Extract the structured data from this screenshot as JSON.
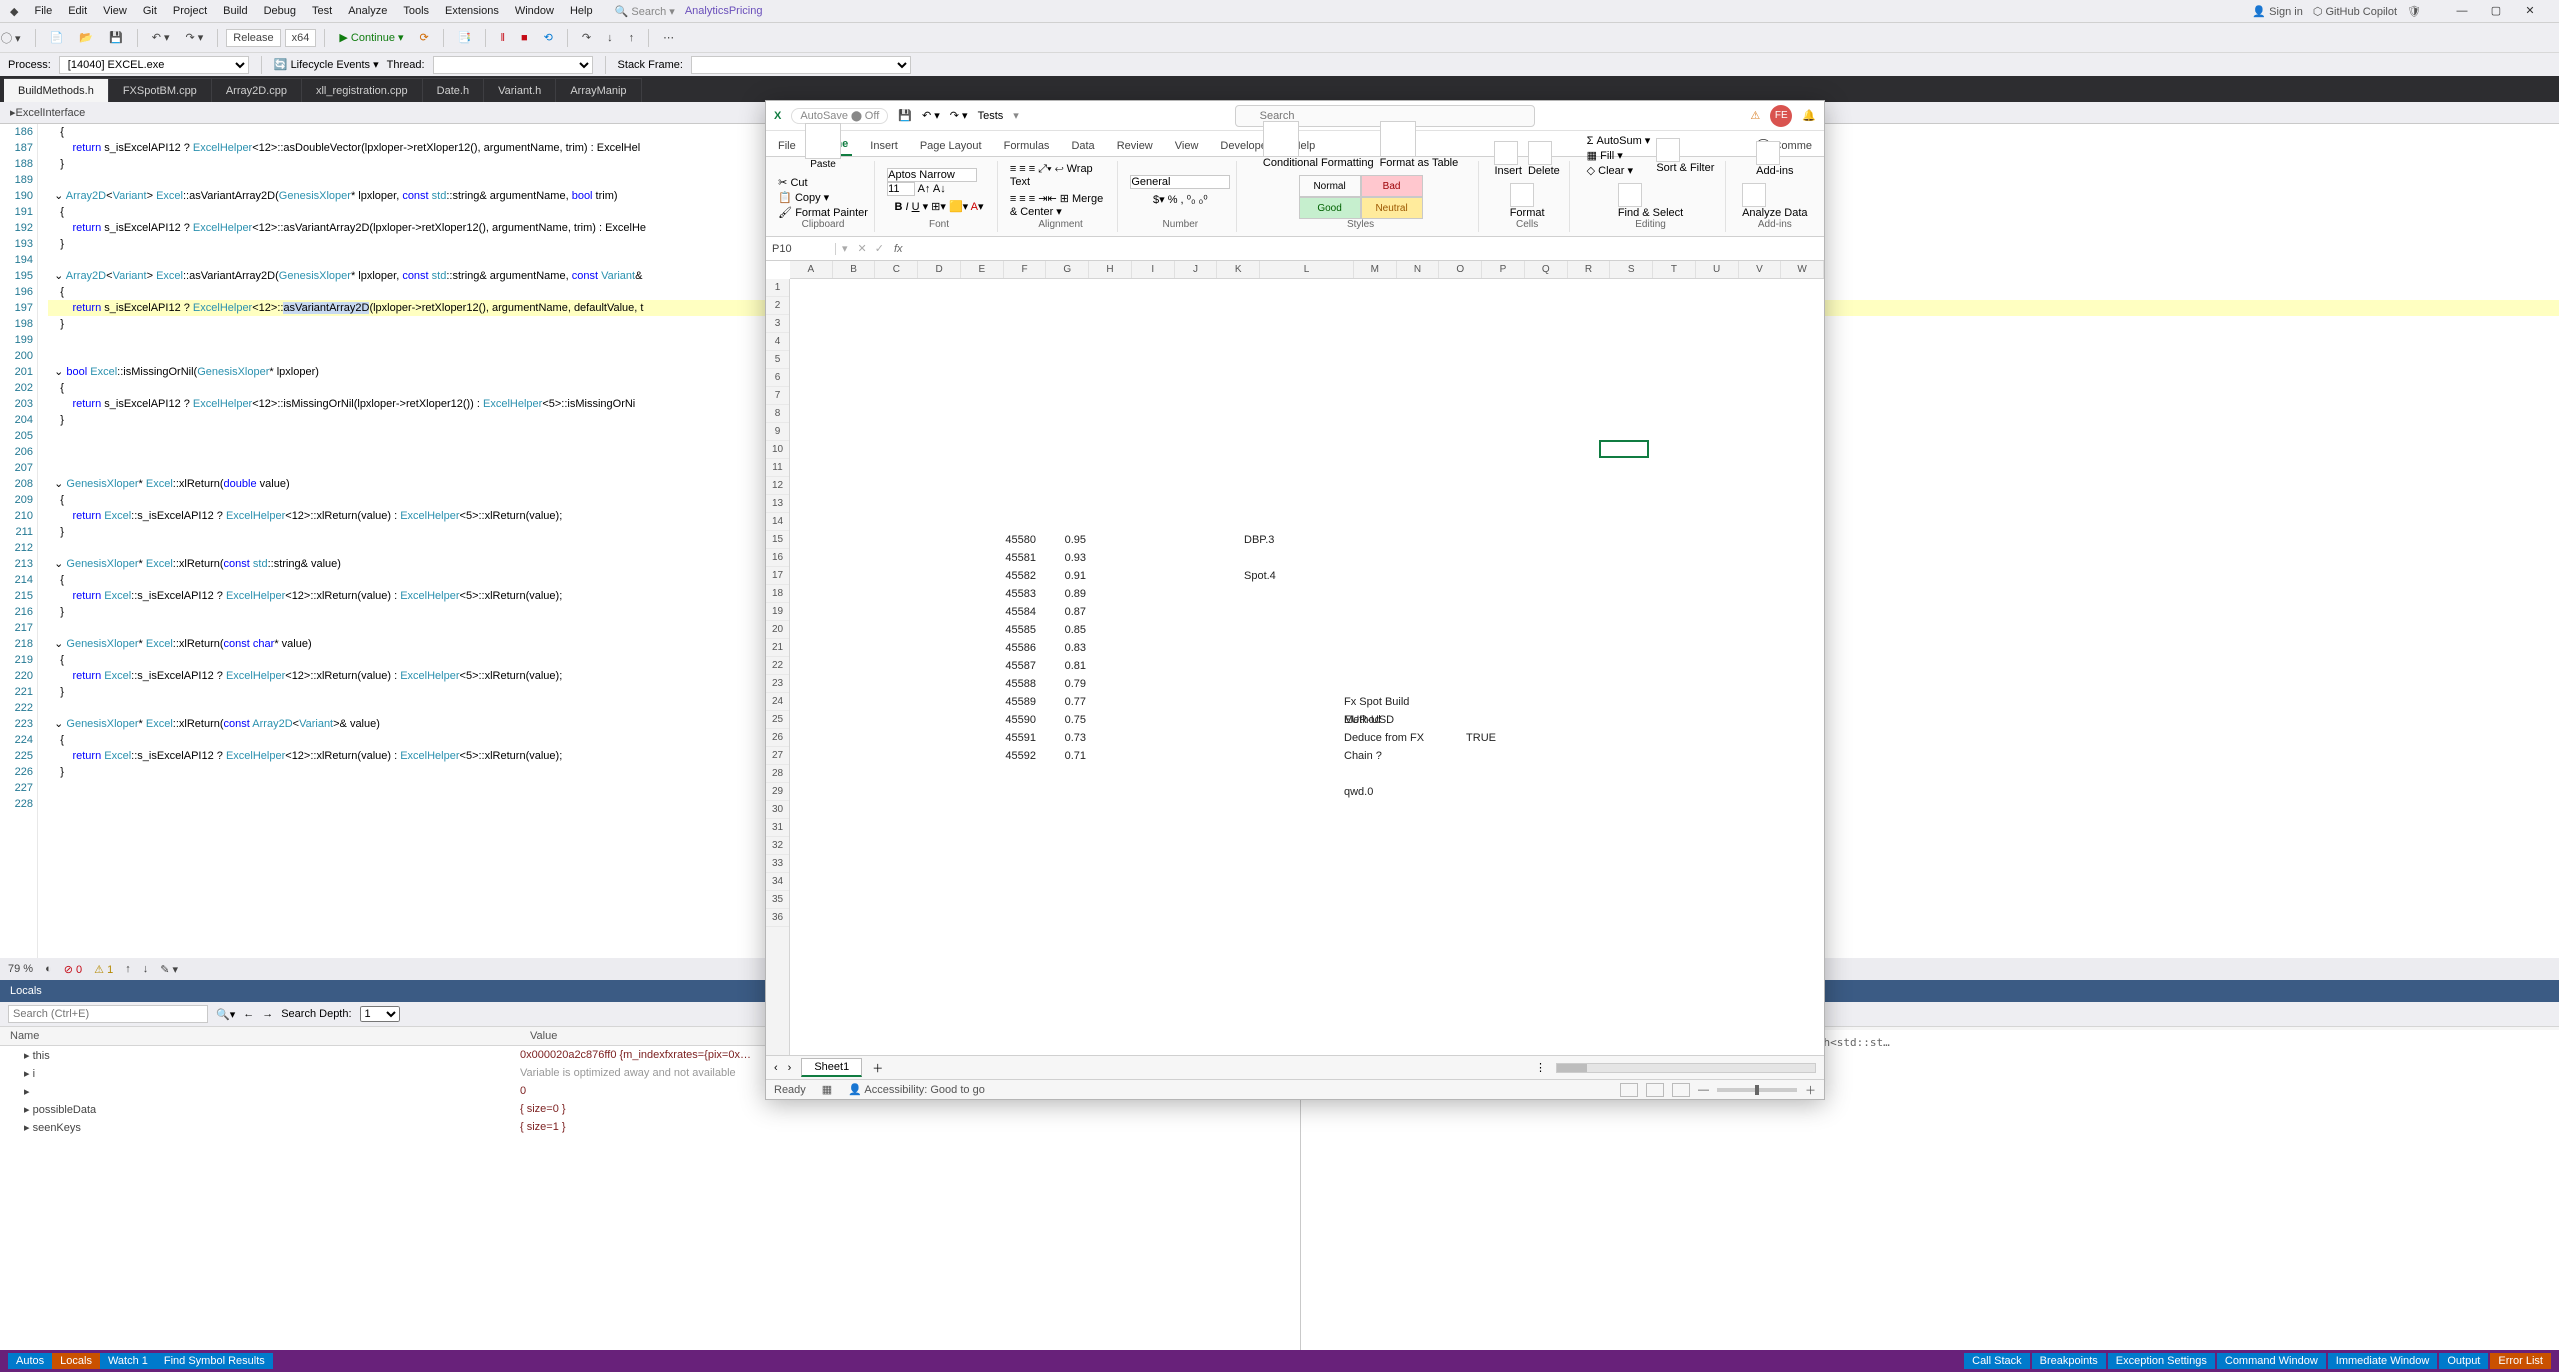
{
  "vs": {
    "menus": [
      "File",
      "Edit",
      "View",
      "Git",
      "Project",
      "Build",
      "Debug",
      "Test",
      "Analyze",
      "Tools",
      "Extensions",
      "Window",
      "Help"
    ],
    "search_placeholder": "Search",
    "right_link": "AnalyticsPricing",
    "signin": "Sign in",
    "copilot": "GitHub Copilot",
    "toolbar": {
      "config": "Release",
      "platform": "x64",
      "continue": "Continue"
    },
    "process": {
      "label": "Process:",
      "value": "[14040] EXCEL.exe",
      "lifecycle": "Lifecycle Events",
      "thread": "Thread:",
      "stack": "Stack Frame:"
    },
    "tabs": [
      "BuildMethods.h",
      "FXSpotBM.cpp",
      "Array2D.cpp",
      "xll_registration.cpp",
      "Date.h",
      "Variant.h",
      "ArrayManip"
    ],
    "active_tab": 0,
    "subheader": "ExcelInterface",
    "code_start_line": 186,
    "lines": [
      "    {",
      "        return s_isExcelAPI12 ? ExcelHelper<12>::asDoubleVector(lpxloper->retXloper12(), argumentName, trim) : ExcelHel",
      "    }",
      "",
      "  ⌄ Array2D<Variant> Excel::asVariantArray2D(GenesisXloper* lpxloper, const std::string& argumentName, bool trim)",
      "    {",
      "        return s_isExcelAPI12 ? ExcelHelper<12>::asVariantArray2D(lpxloper->retXloper12(), argumentName, trim) : ExcelHe",
      "    }",
      "",
      "  ⌄ Array2D<Variant> Excel::asVariantArray2D(GenesisXloper* lpxloper, const std::string& argumentName, const Variant&",
      "    {",
      "        return s_isExcelAPI12 ? ExcelHelper<12>::asVariantArray2D(lpxloper->retXloper12(), argumentName, defaultValue, t",
      "    }",
      "",
      "",
      "  ⌄ bool Excel::isMissingOrNil(GenesisXloper* lpxloper)",
      "    {",
      "        return s_isExcelAPI12 ? ExcelHelper<12>::isMissingOrNil(lpxloper->retXloper12()) : ExcelHelper<5>::isMissingOrNi",
      "    }",
      "",
      "",
      "",
      "  ⌄ GenesisXloper* Excel::xlReturn(double value)",
      "    {",
      "        return Excel::s_isExcelAPI12 ? ExcelHelper<12>::xlReturn(value) : ExcelHelper<5>::xlReturn(value);",
      "    }",
      "",
      "  ⌄ GenesisXloper* Excel::xlReturn(const std::string& value)",
      "    {",
      "        return Excel::s_isExcelAPI12 ? ExcelHelper<12>::xlReturn(value) : ExcelHelper<5>::xlReturn(value);",
      "    }",
      "",
      "  ⌄ GenesisXloper* Excel::xlReturn(const char* value)",
      "    {",
      "        return Excel::s_isExcelAPI12 ? ExcelHelper<12>::xlReturn(value) : ExcelHelper<5>::xlReturn(value);",
      "    }",
      "",
      "  ⌄ GenesisXloper* Excel::xlReturn(const Array2D<Variant>& value)",
      "    {",
      "        return Excel::s_isExcelAPI12 ? ExcelHelper<12>::xlReturn(value) : ExcelHelper<5>::xlReturn(value);",
      "    }",
      "",
      ""
    ],
    "debug_line_index": 11,
    "highlight_token": "asVariantArray2D",
    "midbar": {
      "zoom": "79 %",
      "errors": "0",
      "warnings": "1"
    },
    "locals": {
      "title": "Locals",
      "search_ph": "Search (Ctrl+E)",
      "depth_label": "Search Depth:",
      "depth_value": "1",
      "cols": [
        "Name",
        "Value"
      ],
      "rows": [
        {
          "n": "this",
          "v": "0x000020a2c876ff0 {m_indexfxrates={pix=0x…",
          "gray": false
        },
        {
          "n": "i",
          "v": "Variable is optimized away and not available",
          "gray": true
        },
        {
          "n": "",
          "v": "0",
          "gray": false
        },
        {
          "n": "possibleData",
          "v": "{ size=0 }",
          "gray": false
        },
        {
          "n": "seenKeys",
          "v": "{ size=1 }",
          "gray": false
        }
      ]
    },
    "watch_text": "std::vector<bool,std::allocator<bool>>\nstd::unordered_set<std::string,std::hash<std::st…",
    "bottom_tabs_left": [
      "Autos",
      "Locals",
      "Watch 1",
      "Find Symbol Results"
    ],
    "bottom_tabs_right": [
      "Call Stack",
      "Breakpoints",
      "Exception Settings",
      "Command Window",
      "Immediate Window",
      "Output",
      "Error List"
    ],
    "bottom_active_left": "Locals",
    "bottom_active_right": "Error List"
  },
  "excel": {
    "autosave": "AutoSave",
    "autosave_state": "Off",
    "doc": "Tests",
    "search_ph": "Search",
    "avatar": "FE",
    "tabs": [
      "File",
      "Home",
      "Insert",
      "Page Layout",
      "Formulas",
      "Data",
      "Review",
      "View",
      "Developer",
      "Help"
    ],
    "active_tab": "Home",
    "comments": "Comme",
    "ribbon": {
      "clipboard": {
        "cut": "Cut",
        "copy": "Copy",
        "painter": "Format Painter",
        "label": "Clipboard",
        "paste": "Paste"
      },
      "font": {
        "name": "Aptos Narrow",
        "size": "11",
        "label": "Font"
      },
      "alignment": {
        "wrap": "Wrap Text",
        "merge": "Merge & Center",
        "label": "Alignment"
      },
      "number": {
        "fmt": "General",
        "label": "Number"
      },
      "styles": {
        "cond": "Conditional Formatting",
        "fmt": "Format as Table",
        "cells": [
          "Normal",
          "Bad",
          "Good",
          "Neutral"
        ],
        "label": "Styles"
      },
      "cells": {
        "ins": "Insert",
        "del": "Delete",
        "fmt": "Format",
        "label": "Cells"
      },
      "editing": {
        "sum": "AutoSum",
        "fill": "Fill",
        "clear": "Clear",
        "sort": "Sort & Filter",
        "find": "Find & Select",
        "label": "Editing"
      },
      "addins": {
        "a": "Add-ins",
        "b": "Analyze Data",
        "label": "Add-ins"
      }
    },
    "namebox": "P10",
    "columns": [
      "A",
      "B",
      "C",
      "D",
      "E",
      "F",
      "G",
      "H",
      "I",
      "J",
      "K",
      "L",
      "M",
      "N",
      "O",
      "P",
      "Q",
      "R",
      "S",
      "T",
      "U",
      "V",
      "W"
    ],
    "wide_cols": [
      "L"
    ],
    "rows_visible": 36,
    "cells": [
      {
        "r": 15,
        "c": "E",
        "v": "45580",
        "align": "r"
      },
      {
        "r": 15,
        "c": "F",
        "v": "0.95",
        "align": "r"
      },
      {
        "r": 15,
        "c": "J",
        "v": "DBP.3"
      },
      {
        "r": 16,
        "c": "E",
        "v": "45581",
        "align": "r"
      },
      {
        "r": 16,
        "c": "F",
        "v": "0.93",
        "align": "r"
      },
      {
        "r": 17,
        "c": "E",
        "v": "45582",
        "align": "r"
      },
      {
        "r": 17,
        "c": "F",
        "v": "0.91",
        "align": "r"
      },
      {
        "r": 17,
        "c": "J",
        "v": "Spot.4"
      },
      {
        "r": 18,
        "c": "E",
        "v": "45583",
        "align": "r"
      },
      {
        "r": 18,
        "c": "F",
        "v": "0.89",
        "align": "r"
      },
      {
        "r": 19,
        "c": "E",
        "v": "45584",
        "align": "r"
      },
      {
        "r": 19,
        "c": "F",
        "v": "0.87",
        "align": "r"
      },
      {
        "r": 20,
        "c": "E",
        "v": "45585",
        "align": "r"
      },
      {
        "r": 20,
        "c": "F",
        "v": "0.85",
        "align": "r"
      },
      {
        "r": 21,
        "c": "E",
        "v": "45586",
        "align": "r"
      },
      {
        "r": 21,
        "c": "F",
        "v": "0.83",
        "align": "r"
      },
      {
        "r": 22,
        "c": "E",
        "v": "45587",
        "align": "r"
      },
      {
        "r": 22,
        "c": "F",
        "v": "0.81",
        "align": "r"
      },
      {
        "r": 23,
        "c": "E",
        "v": "45588",
        "align": "r"
      },
      {
        "r": 23,
        "c": "F",
        "v": "0.79",
        "align": "r"
      },
      {
        "r": 24,
        "c": "E",
        "v": "45589",
        "align": "r"
      },
      {
        "r": 24,
        "c": "F",
        "v": "0.77",
        "align": "r"
      },
      {
        "r": 24,
        "c": "L",
        "v": "Fx Spot Build Method"
      },
      {
        "r": 25,
        "c": "E",
        "v": "45590",
        "align": "r"
      },
      {
        "r": 25,
        "c": "F",
        "v": "0.75",
        "align": "r"
      },
      {
        "r": 25,
        "c": "L",
        "v": "EUR-USD"
      },
      {
        "r": 26,
        "c": "E",
        "v": "45591",
        "align": "r"
      },
      {
        "r": 26,
        "c": "F",
        "v": "0.73",
        "align": "r"
      },
      {
        "r": 26,
        "c": "L",
        "v": "Deduce from FX Chain ?"
      },
      {
        "r": 26,
        "c": "M",
        "v": "TRUE",
        "align": "r"
      },
      {
        "r": 27,
        "c": "E",
        "v": "45592",
        "align": "r"
      },
      {
        "r": 27,
        "c": "F",
        "v": "0.71",
        "align": "r"
      },
      {
        "r": 29,
        "c": "L",
        "v": "qwd.0"
      }
    ],
    "selection": {
      "r": 10,
      "c": "P"
    },
    "sheet": "Sheet1",
    "status": {
      "ready": "Ready",
      "acc": "Accessibility: Good to go"
    }
  }
}
